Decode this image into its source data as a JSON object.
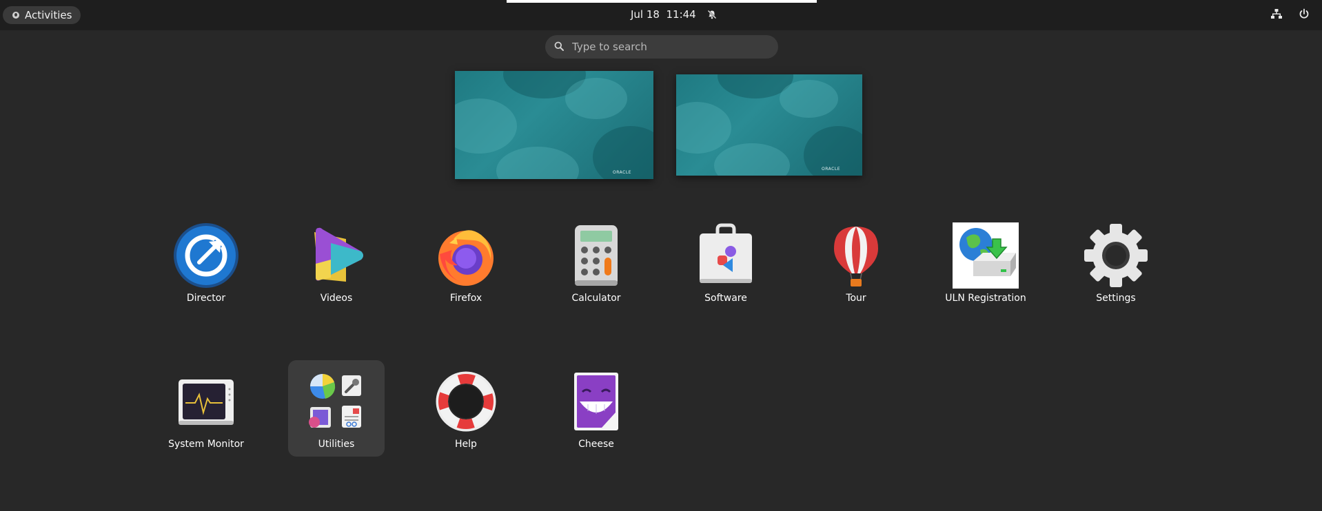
{
  "topbar": {
    "activities_label": "Activities",
    "date": "Jul 18",
    "time": "11:44"
  },
  "search": {
    "placeholder": "Type to search"
  },
  "workspaces": [
    {
      "brand": "ORACLE"
    },
    {
      "brand": "ORACLE"
    }
  ],
  "apps": [
    {
      "label": "Director"
    },
    {
      "label": "Videos"
    },
    {
      "label": "Firefox"
    },
    {
      "label": "Calculator"
    },
    {
      "label": "Software"
    },
    {
      "label": "Tour"
    },
    {
      "label": "ULN Registration"
    },
    {
      "label": "Settings"
    },
    {
      "label": "System Monitor"
    },
    {
      "label": "Utilities"
    },
    {
      "label": "Help"
    },
    {
      "label": "Cheese"
    }
  ],
  "colors": {
    "background": "#282828",
    "topbar": "#1e1e1e",
    "search_bg": "#3c3c3c",
    "folder_bg": "#3c3c3c"
  },
  "icons": [
    "search-icon",
    "bell-muted-icon",
    "network-icon",
    "power-icon"
  ]
}
